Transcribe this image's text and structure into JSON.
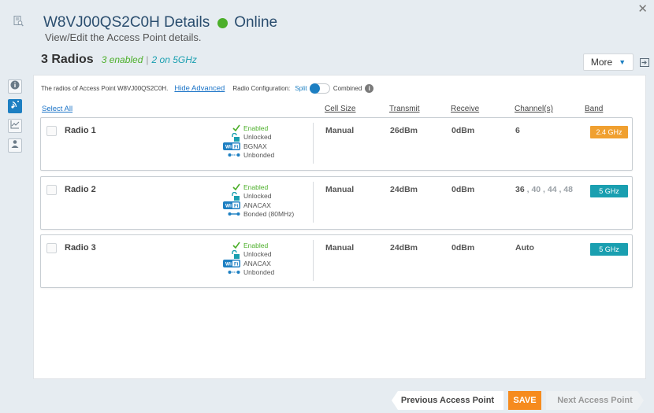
{
  "header": {
    "ap_name": "W8VJ00QS2C0H Details",
    "status": "Online",
    "subtitle": "View/Edit the Access Point details."
  },
  "radios_header": {
    "title": "3 Radios",
    "enabled_summary": "3 enabled",
    "separator": "|",
    "ghz_summary": "2 on 5GHz"
  },
  "toolbar": {
    "more_label": "More"
  },
  "config": {
    "description": "The radios of Access Point W8VJ00QS2C0H.",
    "hide_advanced_label": "Hide Advanced",
    "radio_config_label": "Radio Configuration:",
    "split_label": "Split",
    "combined_label": "Combined",
    "mode": "split"
  },
  "table": {
    "select_all_label": "Select All",
    "columns": {
      "cell_size": "Cell Size",
      "transmit": "Transmit",
      "receive": "Receive",
      "channels": "Channel(s)",
      "band": "Band"
    }
  },
  "radios": [
    {
      "name": "Radio 1",
      "enabled": "Enabled",
      "lock": "Unlocked",
      "mode": "BGNAX",
      "bond": "Unbonded",
      "cell_size": "Manual",
      "transmit": "26dBm",
      "receive": "0dBm",
      "channel_primary": "6",
      "channel_secondary": "",
      "band": "2.4 GHz",
      "band_color": "#f0a030"
    },
    {
      "name": "Radio 2",
      "enabled": "Enabled",
      "lock": "Unlocked",
      "mode": "ANACAX",
      "bond": "Bonded (80MHz)",
      "cell_size": "Manual",
      "transmit": "24dBm",
      "receive": "0dBm",
      "channel_primary": "36",
      "channel_secondary": ", 40 , 44 , 48",
      "band": "5 GHz",
      "band_color": "#1a9fb0"
    },
    {
      "name": "Radio 3",
      "enabled": "Enabled",
      "lock": "Unlocked",
      "mode": "ANACAX",
      "bond": "Unbonded",
      "cell_size": "Manual",
      "transmit": "24dBm",
      "receive": "0dBm",
      "channel_primary": "Auto",
      "channel_secondary": "",
      "band": "5 GHz",
      "band_color": "#1a9fb0"
    }
  ],
  "footer": {
    "prev_label": "Previous Access Point",
    "save_label": "SAVE",
    "next_label": "Next Access Point"
  },
  "colors": {
    "accent": "#1d7fc2",
    "online": "#4caf2a",
    "save": "#f68b1e"
  },
  "icons": {
    "header": "ap-details-icon",
    "sidebar": [
      "info-icon",
      "radio-icon",
      "chart-icon",
      "client-icon"
    ],
    "export": "export-icon"
  }
}
